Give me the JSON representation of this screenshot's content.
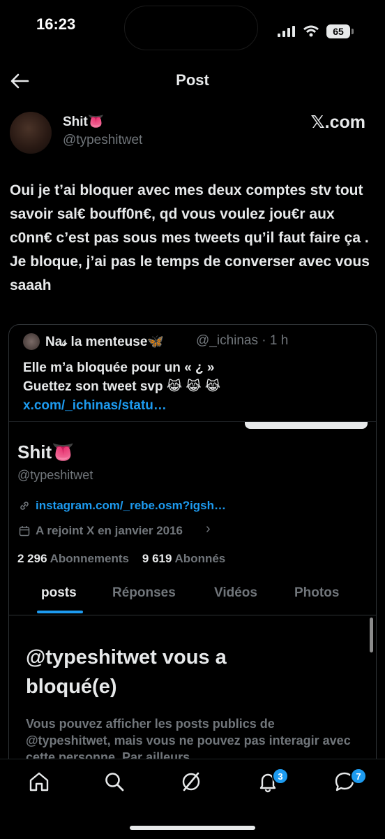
{
  "status_bar": {
    "time": "16:23",
    "battery": "65"
  },
  "header": {
    "title": "Post"
  },
  "post": {
    "display_name": "Shit👅",
    "handle": "@typeshitwet",
    "source": "𝕏.com",
    "text": "Oui je t’ai bloquer avec mes deux comptes stv tout savoir sal€ bouff0n€, qd vous voulez jou€r aux c0nn€ c’est pas sous mes tweets qu’il faut faire ça . Je bloque, j’ai pas le temps de converser avec vous saaah"
  },
  "quote": {
    "name": "Na𝓈 la menteuse🦋",
    "handle": "@_ichinas · 1 h",
    "line1": "Elle m’a bloquée pour un « ¿ »",
    "line2_prefix": "Guettez son tweet svp 😹 😹 😹 ",
    "link": "x.com/_ichinas/statu…",
    "screenshot": {
      "name": "Shit👅",
      "handle": "@typeshitwet",
      "website": "instagram.com/_rebe.osm?igsh…",
      "joined": "A rejoint X en janvier 2016",
      "following_count": "2 296",
      "following_label": "Abonnements",
      "followers_count": "9 619",
      "followers_label": "Abonnés",
      "tabs": [
        "posts",
        "Réponses",
        "Vidéos",
        "Photos"
      ],
      "blocked_title": "@typeshitwet vous a bloqué(e)",
      "blocked_body": "Vous pouvez afficher les posts publics de @typeshitwet, mais vous ne pouvez pas interagir avec cette personne. Par ailleurs"
    }
  },
  "nav": {
    "notifications_badge": "3",
    "messages_badge": "7"
  },
  "colors": {
    "accent": "#1d9bf0",
    "text": "#e7e9ea",
    "muted": "#71767b",
    "background": "#000000"
  }
}
